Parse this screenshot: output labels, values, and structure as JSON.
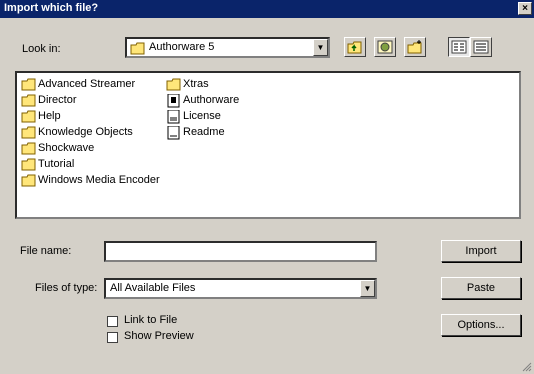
{
  "window": {
    "title": "Import which file?",
    "close_glyph": "×"
  },
  "lookin": {
    "label": "Look in:",
    "value": "Authorware 5"
  },
  "toolbar": {
    "icons": [
      "up-folder-icon",
      "desktop-icon",
      "new-folder-icon",
      "list-view-icon",
      "details-view-icon"
    ]
  },
  "files": {
    "col1": [
      {
        "name": "Advanced Streamer",
        "icon": "folder-icon"
      },
      {
        "name": "Director",
        "icon": "folder-icon"
      },
      {
        "name": "Help",
        "icon": "folder-icon"
      },
      {
        "name": "Knowledge Objects",
        "icon": "folder-icon"
      },
      {
        "name": "Shockwave",
        "icon": "folder-icon"
      },
      {
        "name": "Tutorial",
        "icon": "folder-icon"
      },
      {
        "name": "Windows Media Encoder",
        "icon": "folder-icon"
      }
    ],
    "col2": [
      {
        "name": "Xtras",
        "icon": "folder-icon"
      },
      {
        "name": "Authorware",
        "icon": "application-icon"
      },
      {
        "name": "License",
        "icon": "document-icon"
      },
      {
        "name": "Readme",
        "icon": "document-icon"
      }
    ]
  },
  "filename": {
    "label": "File name:",
    "value": ""
  },
  "filetype": {
    "label": "Files of type:",
    "value": "All Available Files"
  },
  "options": {
    "link_label": "Link to File",
    "preview_label": "Show Preview"
  },
  "buttons": {
    "import": "Import",
    "paste": "Paste",
    "options": "Options..."
  },
  "colors": {
    "titlebar": "#0a246a",
    "dialog": "#d4d0c8",
    "folder": "#ffe67a"
  }
}
